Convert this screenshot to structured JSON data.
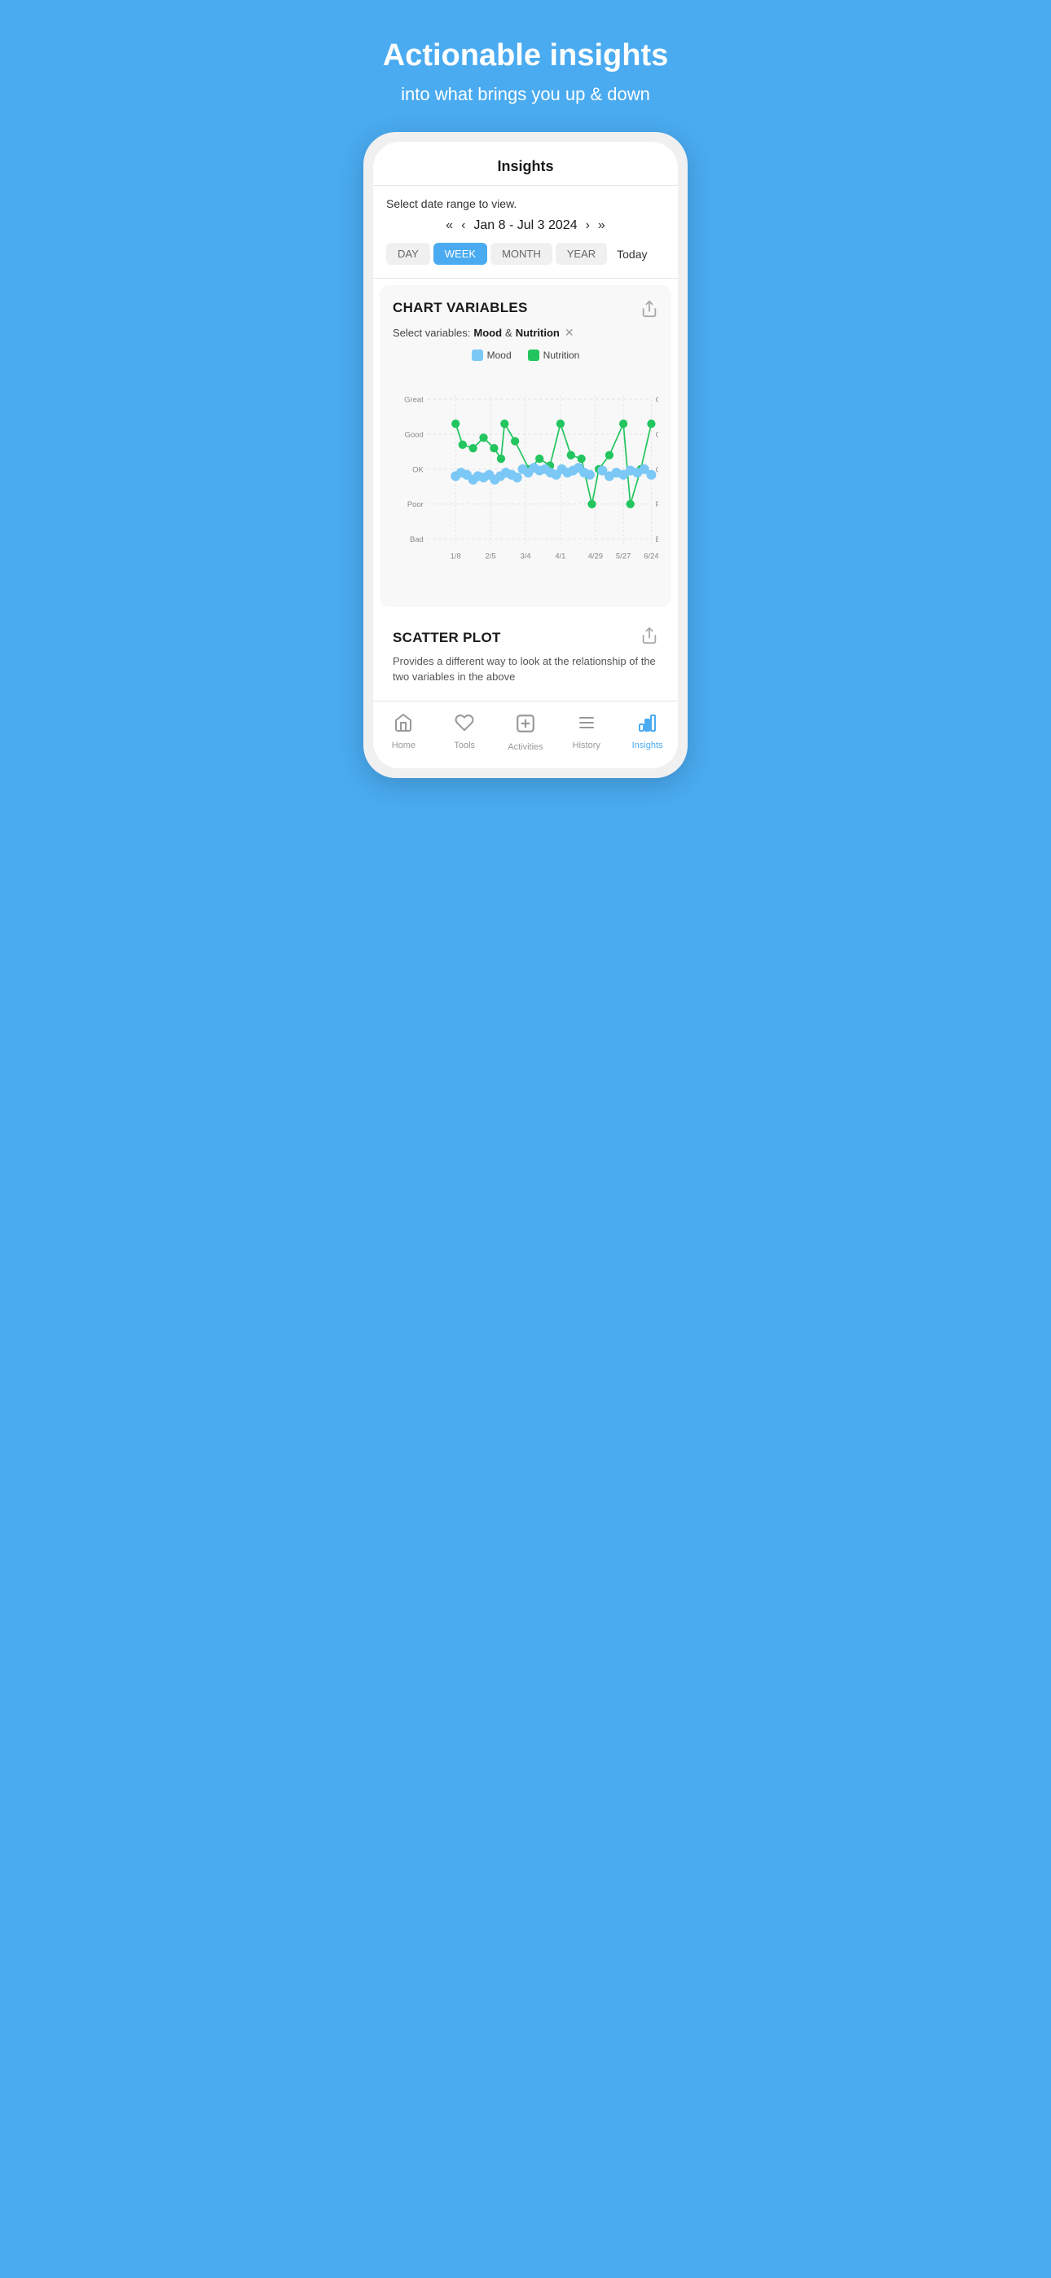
{
  "hero": {
    "title": "Actionable insights",
    "subtitle": "into what brings you up & down"
  },
  "page": {
    "title": "Insights"
  },
  "date_section": {
    "label": "Select date range to view.",
    "range": "Jan 8 - Jul 3",
    "year": "2024",
    "today_label": "Today",
    "periods": [
      "DAY",
      "WEEK",
      "MONTH",
      "YEAR"
    ],
    "active_period": "WEEK"
  },
  "chart_variables": {
    "title": "CHART VARIABLES",
    "select_label": "Select variables:",
    "var1": "Mood",
    "ampersand": "&",
    "var2": "Nutrition",
    "legend": {
      "mood": "Mood",
      "nutrition": "Nutrition"
    },
    "y_labels": [
      "Great",
      "Good",
      "OK",
      "Poor",
      "Bad"
    ],
    "x_labels": [
      "1/8",
      "2/5",
      "3/4",
      "4/1",
      "4/29",
      "5/27",
      "6/24"
    ]
  },
  "scatter_plot": {
    "title": "SCATTER PLOT",
    "description": "Provides a different way to look at the relationship of the two variables in the above"
  },
  "bottom_nav": {
    "items": [
      {
        "id": "home",
        "label": "Home",
        "icon": "🏠",
        "active": false
      },
      {
        "id": "tools",
        "label": "Tools",
        "icon": "🤍",
        "active": false
      },
      {
        "id": "activities",
        "label": "Activities",
        "icon": "➕",
        "active": false
      },
      {
        "id": "history",
        "label": "History",
        "icon": "≡",
        "active": false
      },
      {
        "id": "insights",
        "label": "Insights",
        "icon": "📊",
        "active": true
      }
    ]
  }
}
